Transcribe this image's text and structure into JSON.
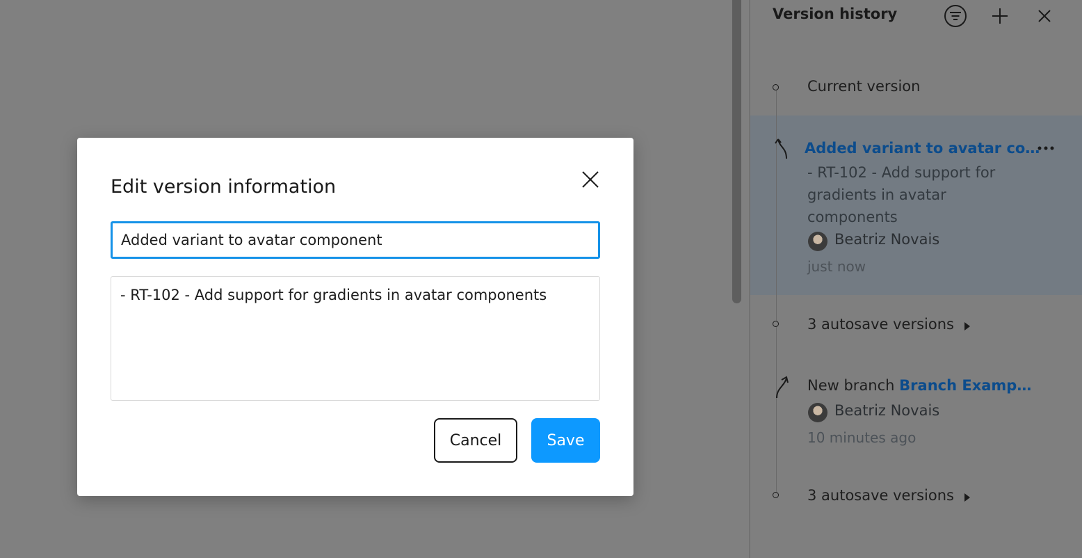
{
  "panel": {
    "title": "Version history",
    "icons": [
      "filter-icon",
      "plus-icon",
      "close-icon"
    ],
    "current_version_label": "Current version",
    "selected_version": {
      "title": "Added variant to avatar co…",
      "description": "- RT-102 - Add support for gradients in avatar components",
      "author": "Beatriz Novais",
      "time": "just now"
    },
    "autosave_1": "3 autosave versions",
    "branch": {
      "prefix": "New branch",
      "link": "Branch Examp…",
      "author": "Beatriz Novais",
      "time": "10 minutes ago"
    },
    "autosave_2": "3 autosave versions"
  },
  "modal": {
    "title": "Edit version information",
    "name_value": "Added variant to avatar component",
    "description_value": "- RT-102 - Add support for gradients in avatar components",
    "cancel_label": "Cancel",
    "save_label": "Save"
  },
  "colors": {
    "accent": "#0d99ff",
    "focus_border": "#1592e8",
    "link": "#0c4c8c",
    "overlay": "#808080"
  }
}
